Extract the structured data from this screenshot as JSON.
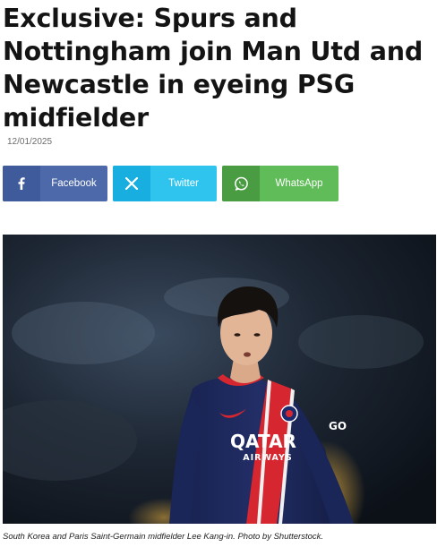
{
  "article": {
    "headline": "Exclusive: Spurs and Nottingham join Man Utd and Newcastle in eyeing PSG midfielder",
    "date": "12/01/2025"
  },
  "share": {
    "facebook": {
      "label": "Facebook",
      "icon": "facebook-icon",
      "color": "#4d69a9"
    },
    "twitter": {
      "label": "Twitter",
      "icon": "x-icon",
      "color": "#2ec4ee"
    },
    "whatsapp": {
      "label": "WhatsApp",
      "icon": "whatsapp-icon",
      "color": "#5fbc58"
    }
  },
  "image": {
    "kit_sponsor": "QATAR",
    "kit_sponsor_sub": "AIRWAYS",
    "sleeve_text": "GO",
    "caption": "South Korea and Paris Saint-Germain midfielder Lee Kang-in. Photo by Shutterstock."
  }
}
